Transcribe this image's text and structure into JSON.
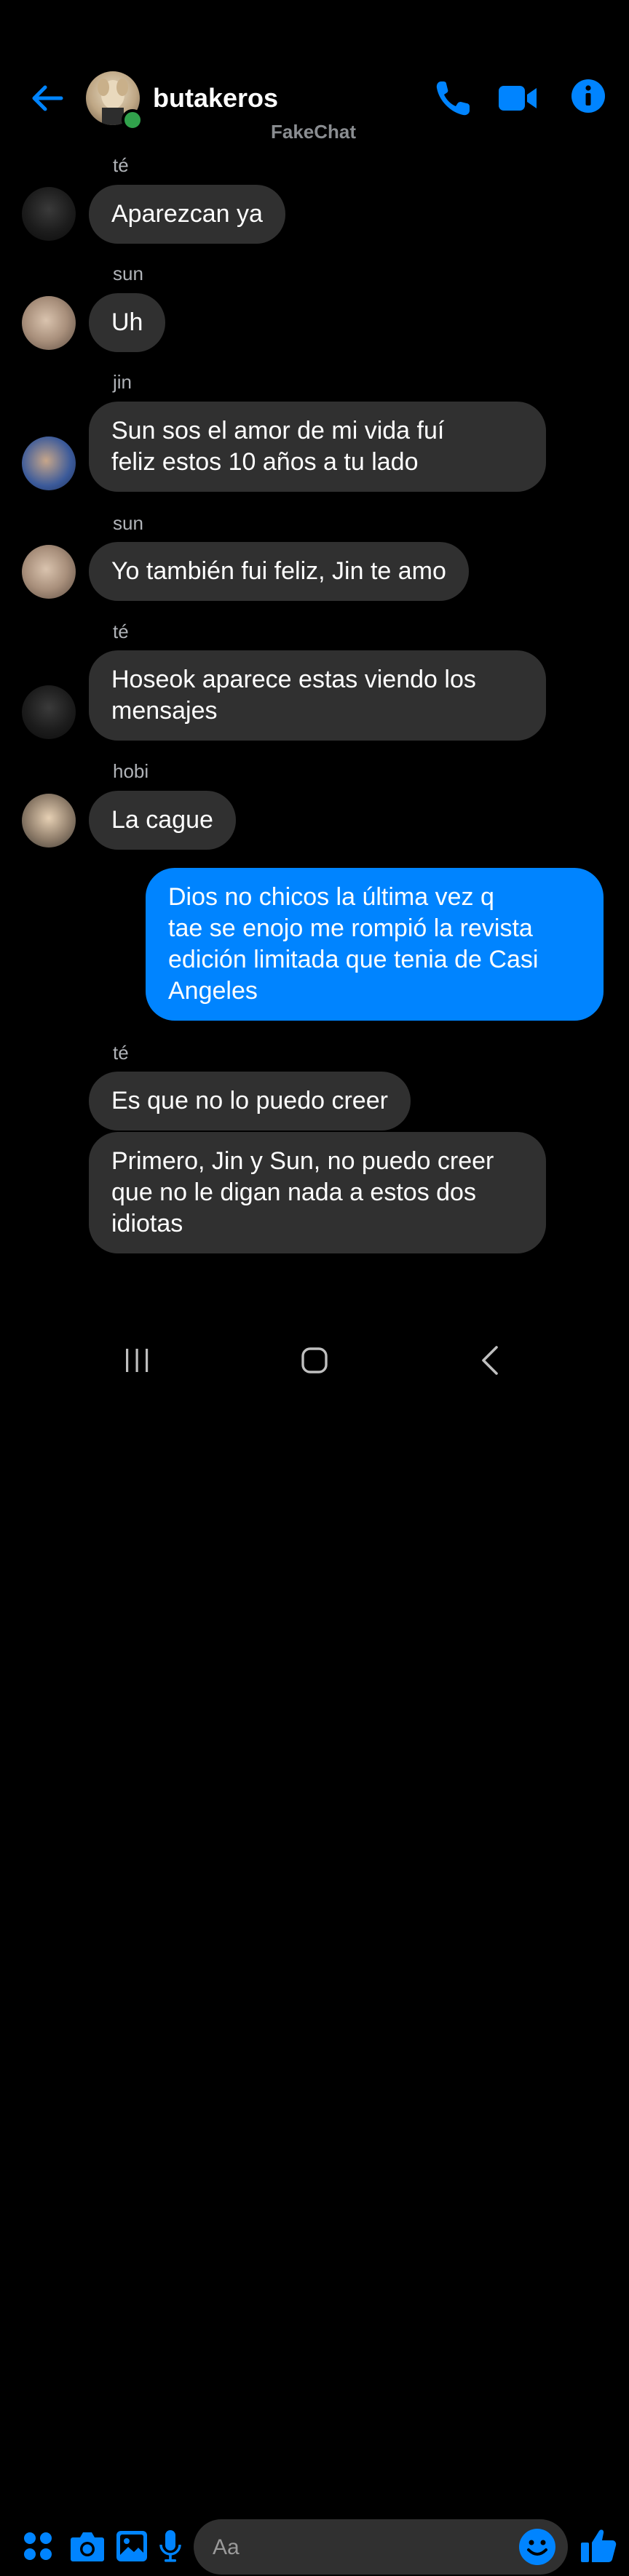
{
  "header": {
    "name": "butakeros",
    "watermark": "FakeChat",
    "accent_color": "#0084ff",
    "icons": [
      "back-arrow-icon",
      "phone-icon",
      "video-camera-icon",
      "info-icon"
    ]
  },
  "messages": [
    {
      "sender": "té",
      "text_lines": [
        "Aparezcan ya"
      ],
      "mine": false
    },
    {
      "sender": "sun",
      "text_lines": [
        "Uh"
      ],
      "mine": false
    },
    {
      "sender": "jin",
      "text_lines": [
        "Sun sos el amor  de mi vida fuí",
        "feliz estos 10 años a tu lado"
      ],
      "mine": false
    },
    {
      "sender": "sun",
      "text_lines": [
        "Yo también fui feliz, Jin te amo"
      ],
      "mine": false
    },
    {
      "sender": "té",
      "text_lines": [
        "Hoseok aparece estas viendo los",
        "mensajes"
      ],
      "mine": false
    },
    {
      "sender": "hobi",
      "text_lines": [
        "La cague"
      ],
      "mine": false
    },
    {
      "sender": "",
      "text_lines": [
        "Dios no chicos la última vez q",
        "tae se enojo me rompió la revista",
        "edición limitada que tenia de Casi",
        "Angeles"
      ],
      "mine": true
    },
    {
      "sender": "té",
      "text_lines": [
        "Es que no lo puedo creer"
      ],
      "mine": false
    },
    {
      "sender": "",
      "text_lines": [
        "Primero, Jin y Sun, no puedo creer",
        "que no le digan nada a estos dos",
        "idiotas"
      ],
      "mine": false
    }
  ],
  "composer": {
    "placeholder": "Aa",
    "icons": [
      "apps-icon",
      "camera-icon",
      "gallery-icon",
      "microphone-icon",
      "emoji-icon",
      "thumbs-up-icon"
    ]
  },
  "navbar": {
    "icons": [
      "recent-apps-icon",
      "home-icon",
      "back-icon"
    ]
  }
}
